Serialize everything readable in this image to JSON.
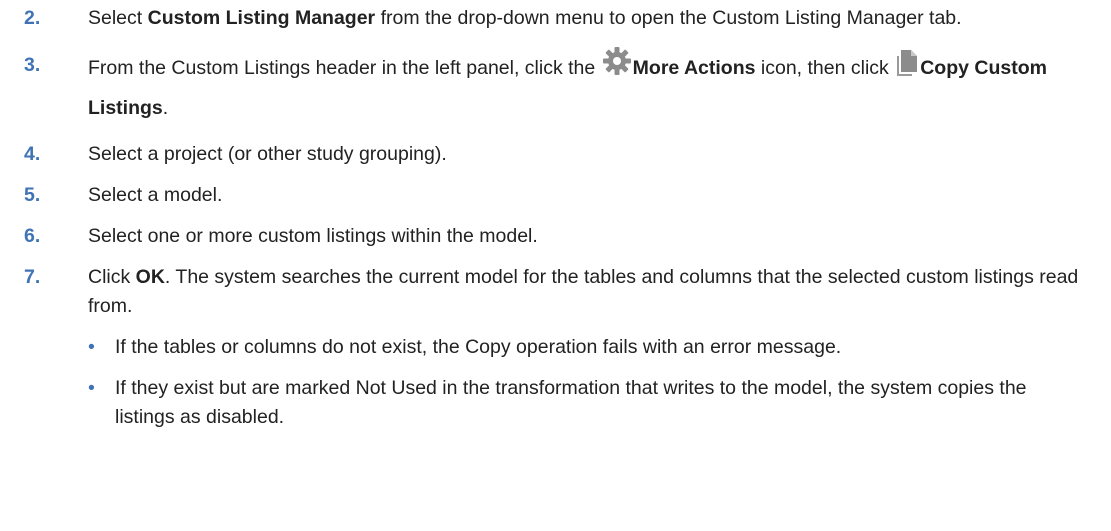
{
  "steps": [
    {
      "number": "2.",
      "pre": "Select ",
      "bold": "Custom Listing Manager",
      "post": " from the drop-down menu to open the Custom Listing Manager tab."
    },
    {
      "number": "3.",
      "pre": "From the Custom Listings header in the left panel, click the ",
      "icon1": "gear-icon",
      "bold1": "More Actions",
      "mid": " icon, then click ",
      "icon2": "copy-icon",
      "bold2": "Copy Custom Listings",
      "post": "."
    },
    {
      "number": "4.",
      "text": "Select a project (or other study grouping)."
    },
    {
      "number": "5.",
      "text": "Select a model."
    },
    {
      "number": "6.",
      "text": "Select one or more custom listings within the model."
    },
    {
      "number": "7.",
      "pre": "Click ",
      "bold": "OK",
      "post": ". The system searches the current model for the tables and columns that the selected custom listings read from.",
      "bullets": [
        "If the tables or columns do not exist, the Copy operation fails with an error message.",
        "If they exist but are marked Not Used in the transformation that writes to the model, the system copies the listings as disabled."
      ]
    }
  ],
  "bullet_glyph": "•",
  "colors": {
    "accent": "#3f73b6",
    "text": "#222222",
    "icon": "#8c8c8c"
  }
}
